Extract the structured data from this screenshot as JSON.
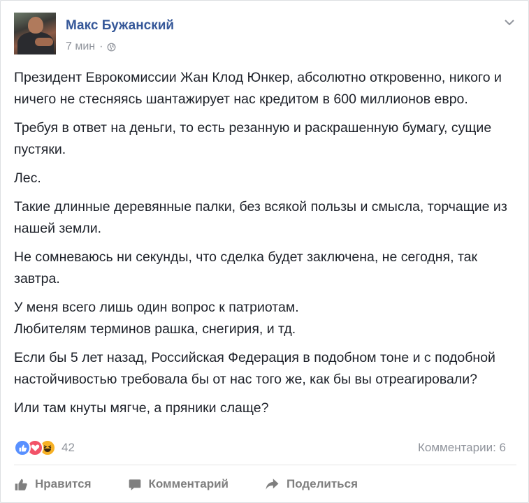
{
  "post": {
    "author": "Макс Бужанский",
    "time": "7 мин",
    "separator": "·",
    "privacy_icon": "globe-icon",
    "menu_icon": "chevron-down-icon",
    "paragraphs": [
      "Президент Еврокомиссии Жан Клод Юнкер, абсолютно откровенно, никого и ничего не стесняясь шантажирует нас кредитом в 600 миллионов евро.",
      "Требуя в ответ на деньги, то есть резанную и раскрашенную бумагу, сущие пустяки.",
      "Лес.",
      "Такие длинные деревянные палки, без всякой пользы и смысла, торчащие из нашей земли.",
      "Не сомневаюсь ни секунды, что сделка будет заключена, не сегодня, так завтра.",
      "У меня всего лишь один вопрос к патриотам.\nЛюбителям терминов рашка, снегирия, и тд.",
      "Если бы 5 лет назад, Российская Федерация в подобном тоне и с подобной настойчивостью требовала бы от нас того же, как бы вы отреагировали?",
      "Или там кнуты мягче, а пряники слаще?"
    ]
  },
  "reactions": {
    "icons": [
      "like-icon",
      "love-icon",
      "haha-icon"
    ],
    "count": "42",
    "comments": "Комментарии: 6"
  },
  "actions": {
    "like": "Нравится",
    "comment": "Комментарий",
    "share": "Поделиться"
  },
  "colors": {
    "name": "#365899",
    "meta": "#90949c",
    "text": "#1d2129",
    "like": "#5890ff",
    "love": "#f25268",
    "haha": "#f7b125"
  }
}
